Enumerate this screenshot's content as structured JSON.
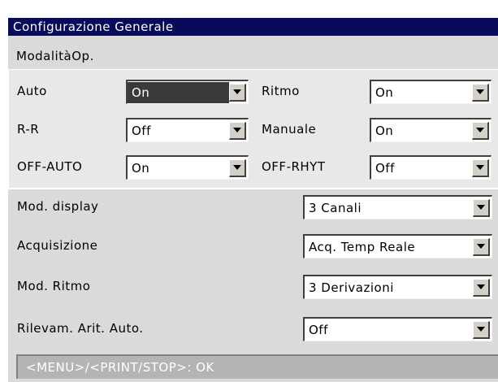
{
  "window": {
    "title": "Configurazione Generale"
  },
  "section": {
    "label": "ModalitàOp."
  },
  "group": [
    {
      "label": "Auto",
      "value": "On"
    },
    {
      "label": "Ritmo",
      "value": "On"
    },
    {
      "label": "R-R",
      "value": "Off"
    },
    {
      "label": "Manuale",
      "value": "On"
    },
    {
      "label": "OFF-AUTO",
      "value": "On"
    },
    {
      "label": "OFF-RHYT",
      "value": "Off"
    }
  ],
  "settings": [
    {
      "label": "Mod. display",
      "value": "3 Canali"
    },
    {
      "label": "Acquisizione",
      "value": "Acq. Temp Reale"
    },
    {
      "label": "Mod. Ritmo",
      "value": "3 Derivazioni"
    },
    {
      "label": "Rilevam. Arit. Auto.",
      "value": "Off"
    }
  ],
  "status": {
    "text": "<MENU>/<PRINT/STOP>: OK"
  },
  "colors": {
    "title_bg": "#0a0a5a",
    "selected_bg": "#3a3a3a",
    "panel_bg": "#dadada"
  }
}
